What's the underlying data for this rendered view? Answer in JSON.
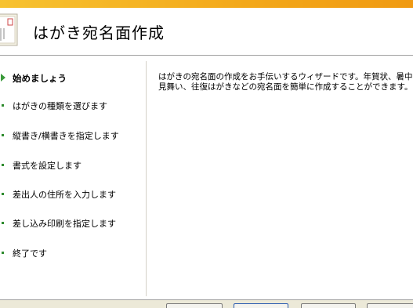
{
  "header": {
    "title": "はがき宛名面作成"
  },
  "sidebar": {
    "steps": [
      {
        "label": "始めましょう",
        "active": true
      },
      {
        "label": "はがきの種類を選びます",
        "active": false
      },
      {
        "label": "縦書き/横書きを指定します",
        "active": false
      },
      {
        "label": "書式を設定します",
        "active": false
      },
      {
        "label": "差出人の住所を入力します",
        "active": false
      },
      {
        "label": "差し込み印刷を指定します",
        "active": false
      },
      {
        "label": "終了です",
        "active": false
      }
    ]
  },
  "content": {
    "description": "はがきの宛名面の作成をお手伝いするウィザードです。年賀状、暑中\n見舞い、往復はがきなどの宛名面を簡単に作成することができます。"
  },
  "colors": {
    "accent_stripe": "#f3a81a",
    "step_bullet": "#3a9a3a"
  },
  "icons": {
    "header": "postcard-icon"
  }
}
